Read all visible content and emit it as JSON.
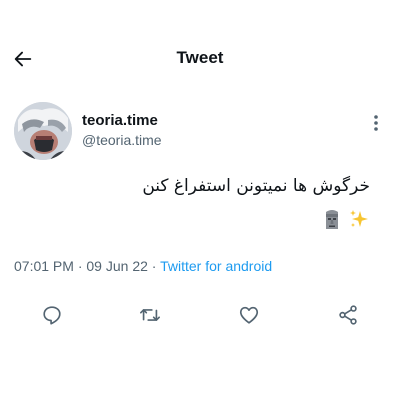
{
  "header": {
    "title": "Tweet",
    "back_icon": "arrow-left-icon"
  },
  "author": {
    "display_name": "teoria.time",
    "handle": "@teoria.time",
    "more_icon": "more-vertical-icon"
  },
  "tweet": {
    "text": "خرگوش ها نمیتونن استفراغ کنن",
    "emojis": [
      "moai-icon",
      "sparkles-icon"
    ]
  },
  "meta": {
    "time": "07:01 PM",
    "sep1": " · ",
    "date": "09 Jun 22",
    "sep2": " · ",
    "source": "Twitter for android"
  },
  "actions": [
    {
      "name": "reply",
      "icon": "reply-icon"
    },
    {
      "name": "retweet",
      "icon": "retweet-icon"
    },
    {
      "name": "like",
      "icon": "heart-icon"
    },
    {
      "name": "share",
      "icon": "share-icon"
    }
  ],
  "colors": {
    "text": "#0f1419",
    "muted": "#536471",
    "link": "#1d9bf0",
    "background": "#ffffff"
  }
}
